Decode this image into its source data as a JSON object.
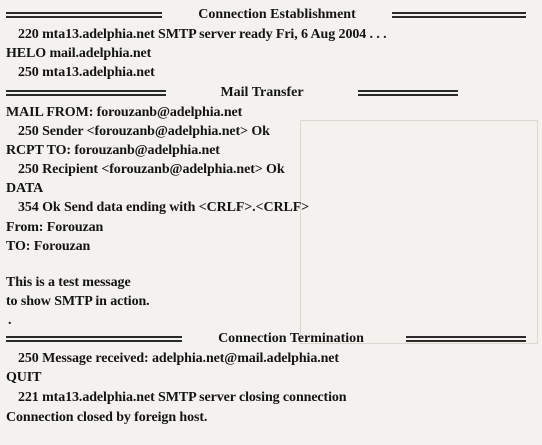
{
  "sections": {
    "establishment_title": "Connection Establishment",
    "transfer_title": "Mail Transfer",
    "termination_title": "Connection Termination"
  },
  "lines": {
    "l1": "220 mta13.adelphia.net SMTP server ready Fri, 6 Aug 2004 . . .",
    "l2": "HELO mail.adelphia.net",
    "l3": "250 mta13.adelphia.net",
    "l4": "MAIL FROM: forouzanb@adelphia.net",
    "l5": "250 Sender <forouzanb@adelphia.net> Ok",
    "l6": "RCPT TO: forouzanb@adelphia.net",
    "l7": "250 Recipient <forouzanb@adelphia.net> Ok",
    "l8": "DATA",
    "l9": "354 Ok Send data ending with <CRLF>.<CRLF>",
    "l10": "From: Forouzan",
    "l11": "TO: Forouzan",
    "l12": "This is a test message",
    "l13": "to show SMTP in action.",
    "l14": ".",
    "l15": "250 Message received: adelphia.net@mail.adelphia.net",
    "l16": "QUIT",
    "l17": "221 mta13.adelphia.net SMTP server closing connection",
    "l18": "Connection closed by foreign host."
  }
}
